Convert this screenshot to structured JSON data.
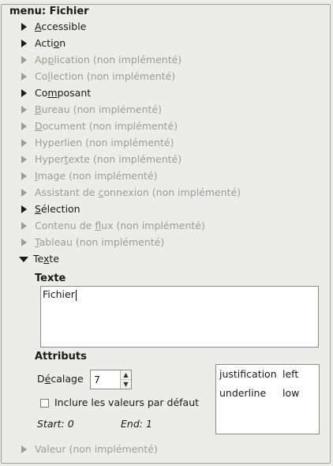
{
  "frame_title": "menu: Fichier",
  "items": [
    {
      "pre": "",
      "ul": "A",
      "post": "ccessible",
      "dim": false
    },
    {
      "pre": "Acti",
      "ul": "o",
      "post": "n",
      "dim": false
    },
    {
      "pre": "Ap",
      "ul": "p",
      "post": "lication (non implémenté)",
      "dim": true
    },
    {
      "pre": "Co",
      "ul": "l",
      "post": "lection (non implémenté)",
      "dim": true
    },
    {
      "pre": "Co",
      "ul": "m",
      "post": "posant",
      "dim": false
    },
    {
      "pre": "",
      "ul": "B",
      "post": "ureau (non implémenté)",
      "dim": true
    },
    {
      "pre": "",
      "ul": "D",
      "post": "ocument (non implémenté)",
      "dim": true
    },
    {
      "pre": "Hyperlien (non implémenté)",
      "ul": "",
      "post": "",
      "dim": true
    },
    {
      "pre": "Hyper",
      "ul": "t",
      "post": "exte (non implémenté)",
      "dim": true
    },
    {
      "pre": "",
      "ul": "I",
      "post": "mage (non implémenté)",
      "dim": true
    },
    {
      "pre": "Assistant de ",
      "ul": "c",
      "post": "onnexion (non implémenté)",
      "dim": true
    },
    {
      "pre": "",
      "ul": "S",
      "post": "élection",
      "dim": false
    },
    {
      "pre": "Contenu de ",
      "ul": "f",
      "post": "lux (non implémenté)",
      "dim": true
    },
    {
      "pre": "",
      "ul": "T",
      "post": "ableau (non implémenté)",
      "dim": true
    }
  ],
  "texte_item": {
    "pre": "Te",
    "ul": "x",
    "post": "te"
  },
  "texte_section": {
    "title": "Texte",
    "value": "Fichier"
  },
  "attributs": {
    "title": "Attributs",
    "offset_label_pre": "D",
    "offset_label_ul": "é",
    "offset_label_post": "calage",
    "offset_value": "7",
    "include_defaults_label": "Inclure les valeurs par défaut",
    "start_label": "Start: 0",
    "end_label": "End: 1",
    "rows": [
      {
        "key": "justification",
        "value": "left"
      },
      {
        "key": "underline",
        "value": "low"
      }
    ]
  },
  "valeur_item": {
    "pre": "Valeur (non implémenté)",
    "ul": "",
    "post": ""
  }
}
